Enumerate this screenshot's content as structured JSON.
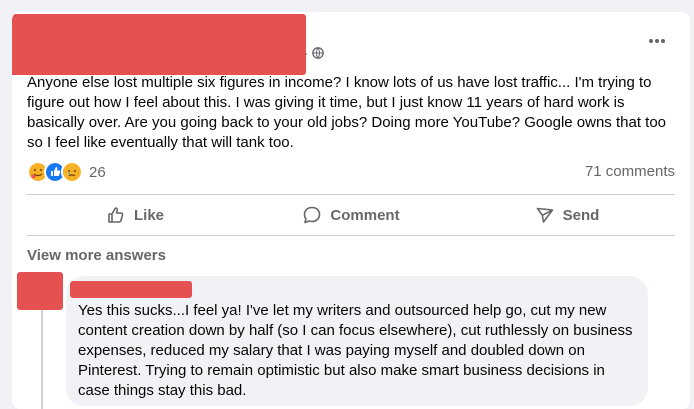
{
  "post": {
    "body": "Anyone else lost multiple six figures in income? I know lots of us have lost traffic... I'm trying to figure out how I feel about this. I was giving it time, but I just know 11 years of hard work is basically over. Are you going back to your old jobs? Doing more YouTube? Google owns that too so I feel like eventually that will tank too.",
    "separator": "·",
    "reaction_count": "26",
    "comment_count": "71 comments",
    "reaction_icons": [
      "care-reaction-icon",
      "like-reaction-icon",
      "sad-reaction-icon"
    ]
  },
  "actions": {
    "like": "Like",
    "comment": "Comment",
    "send": "Send"
  },
  "comments_section": {
    "view_more": "View more answers",
    "comment": {
      "text": "Yes this sucks...I feel ya! I've let my writers and outsourced help go, cut my new content creation down by half (so I can focus elsewhere), cut ruthlessly on business expenses, reduced my salary that I was paying myself and doubled down on Pinterest. Trying to remain optimistic but also make smart business decisions in case things stay this bad."
    }
  },
  "colors": {
    "redaction": "#e55151",
    "secondary_text": "#65676b",
    "like_blue": "#1877f2"
  }
}
